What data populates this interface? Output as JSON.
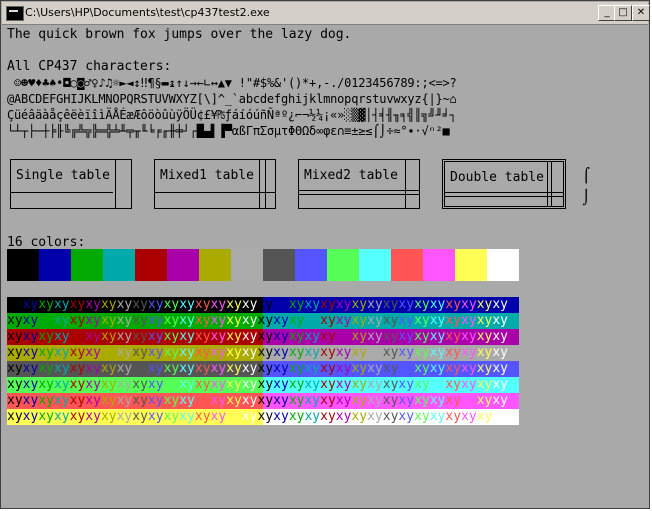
{
  "window": {
    "title": "C:\\Users\\HP\\Documents\\test\\cp437test2.exe",
    "buttons": {
      "minimize": "_",
      "maximize": "□",
      "close": "✕"
    }
  },
  "content": {
    "line1": "The quick brown fox jumps over the lazy dog.",
    "line2": "All CP437 characters:",
    "cp437_rows": [
      " ☺☻♥♦♣♠•◘○◙♂♀♪♫☼►◄↕‼¶§▬↨↑↓→←∟↔▲▼ !\"#$%&'()*+,-./0123456789:;<=>?",
      "@ABCDEFGHIJKLMNOPQRSTUVWXYZ[\\]^_`abcdefghijklmnopqrstuvwxyz{|}~⌂",
      "ÇüéâäàåçêëèïîìÄÅÉæÆôöòûùÿÖÜ¢£¥₧ƒáíóúñÑªº¿⌐¬½¼¡«»░▒▓│┤╡╢╖╕╣║╗╝╜╛┐",
      "└┴┬├─┼╞╟╚╔╩╦╠═╬╧╨╤╥╙╘╒╓╫╪┘┌█▄▌▐▀αßΓπΣσµτΦΘΩδ∞φε∩≡±≥≤⌠⌡÷≈°∙·√ⁿ²■"
    ],
    "tables": [
      "Single table",
      "Mixed1 table",
      "Mixed2 table",
      "Double table"
    ],
    "integral": "⌠\n⌡",
    "colors_label": "16 colors:",
    "stripe_text": "xyxyxyxyxyxyxyxyxyxyxyxyxyxyxyxyxyxyxyxyxyxyxyxyxyxyxyxyxyxyxyxy",
    "palette": [
      "#000000",
      "#0000aa",
      "#00aa00",
      "#00aaaa",
      "#aa0000",
      "#aa00aa",
      "#aaaa00",
      "#aaaaaa",
      "#555555",
      "#5555ff",
      "#55ff55",
      "#55ffff",
      "#ff5555",
      "#ff55ff",
      "#ffff55",
      "#ffffff"
    ]
  }
}
